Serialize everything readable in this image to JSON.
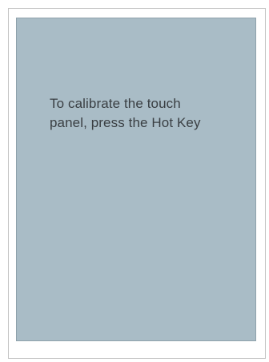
{
  "screen": {
    "message_line_1": "To calibrate the touch",
    "message_line_2": "panel, press the Hot Key",
    "background_color": "#a9bcc6",
    "text_color": "#3a3f43"
  }
}
